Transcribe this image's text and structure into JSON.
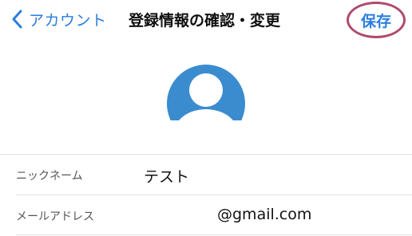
{
  "nav": {
    "back_label": "アカウント",
    "title": "登録情報の確認・変更",
    "save_label": "保存"
  },
  "colors": {
    "accent": "#2b7de0",
    "avatar": "#3a8ccf",
    "highlight_circle": "#b04a6c",
    "divider": "#e3e3e3"
  },
  "profile": {
    "avatar_icon": "user-avatar-icon"
  },
  "fields": [
    {
      "label": "ニックネーム",
      "value": "テスト"
    },
    {
      "label": "メールアドレス",
      "value": "@gmail.com"
    }
  ]
}
